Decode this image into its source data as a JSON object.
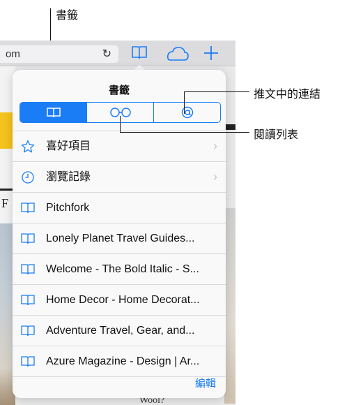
{
  "browser_toolbar": {
    "url_text": "om",
    "reload_glyph": "↻"
  },
  "background_page": {
    "strip_letter": "F",
    "bottom_text": "Wool?"
  },
  "popover": {
    "title": "書籤",
    "segments": [
      {
        "name": "bookmarks",
        "icon": "book-icon",
        "selected": true
      },
      {
        "name": "reading-list",
        "icon": "glasses-icon",
        "selected": false
      },
      {
        "name": "shared-links",
        "icon": "at-icon",
        "selected": false
      }
    ],
    "items": [
      {
        "icon": "star-icon",
        "label": "喜好項目",
        "chevron": "›"
      },
      {
        "icon": "clock-icon",
        "label": "瀏覽記錄",
        "chevron": "›"
      },
      {
        "icon": "book-icon",
        "label": "Pitchfork"
      },
      {
        "icon": "book-icon",
        "label": "Lonely Planet Travel Guides..."
      },
      {
        "icon": "book-icon",
        "label": "Welcome - The Bold Italic - S..."
      },
      {
        "icon": "book-icon",
        "label": "Home Decor - Home Decorat..."
      },
      {
        "icon": "book-icon",
        "label": "Adventure Travel, Gear, and..."
      },
      {
        "icon": "book-icon",
        "label": "Azure Magazine - Design | Ar..."
      }
    ],
    "edit_label": "編輯"
  },
  "callouts": {
    "bookmarks": "書籤",
    "shared_links": "推文中的連結",
    "reading_list": "閱讀列表"
  },
  "colors": {
    "accent": "#1a7df6",
    "popover_bg": "#f9f9fa"
  }
}
